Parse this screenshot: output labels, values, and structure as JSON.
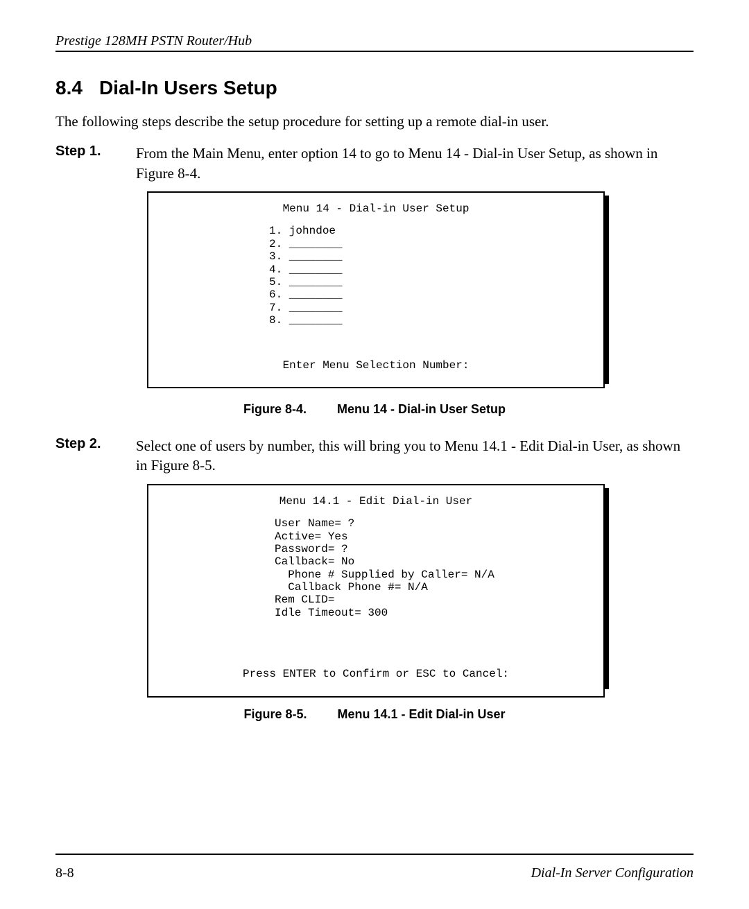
{
  "running_head": "Prestige 128MH  PSTN Router/Hub",
  "section": {
    "number": "8.4",
    "title": "Dial-In Users Setup"
  },
  "intro": "The following steps describe the setup procedure for setting up a remote dial-in user.",
  "steps": [
    {
      "label": "Step 1.",
      "body": "From the Main Menu, enter option 14 to go to Menu 14 - Dial-in User Setup, as shown in Figure 8-4."
    },
    {
      "label": "Step 2.",
      "body": "Select one of users by number, this will bring you to Menu 14.1 - Edit Dial-in User, as shown in Figure 8-5."
    }
  ],
  "figure1": {
    "title": "Menu 14 - Dial-in User Setup",
    "rows": [
      "1. johndoe",
      "2. ________",
      "3. ________",
      "4. ________",
      "5. ________",
      "6. ________",
      "7. ________",
      "8. ________"
    ],
    "prompt": "Enter Menu Selection Number:",
    "caption_label": "Figure 8-4.",
    "caption_title": "Menu 14 - Dial-in User Setup"
  },
  "figure2": {
    "title": "Menu 14.1 - Edit Dial-in User",
    "fields": [
      "User Name= ?",
      "Active= Yes",
      "Password= ?",
      "Callback= No",
      "  Phone # Supplied by Caller= N/A",
      "  Callback Phone #= N/A",
      "Rem CLID=",
      "Idle Timeout= 300"
    ],
    "prompt": "Press ENTER to Confirm or ESC to Cancel:",
    "caption_label": "Figure 8-5.",
    "caption_title": "Menu 14.1 - Edit Dial-in User"
  },
  "footer": {
    "page": "8-8",
    "chapter": "Dial-In Server Configuration"
  }
}
